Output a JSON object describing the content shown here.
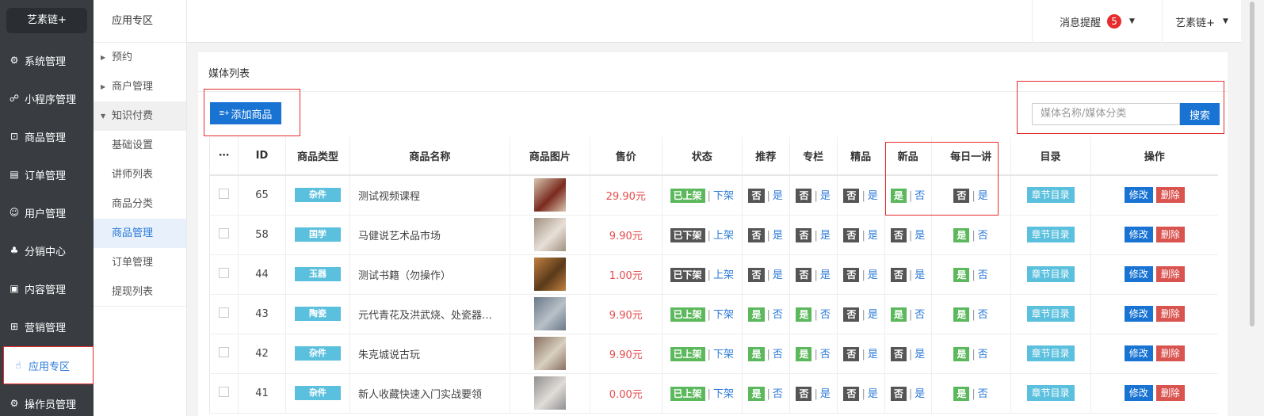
{
  "brand": "艺素链+",
  "sidebar": {
    "items": [
      {
        "label": "系统管理",
        "icon": "⚙"
      },
      {
        "label": "小程序管理",
        "icon": "☍"
      },
      {
        "label": "商品管理",
        "icon": "⊡"
      },
      {
        "label": "订单管理",
        "icon": "▤"
      },
      {
        "label": "用户管理",
        "icon": "☺"
      },
      {
        "label": "分销中心",
        "icon": "♣"
      },
      {
        "label": "内容管理",
        "icon": "▣"
      },
      {
        "label": "营销管理",
        "icon": "⊞"
      },
      {
        "label": "应用专区",
        "icon": "☝"
      },
      {
        "label": "操作员管理",
        "icon": "⚙"
      }
    ]
  },
  "subnav": {
    "title": "应用专区",
    "groups": [
      {
        "label": "预约"
      },
      {
        "label": "商户管理"
      },
      {
        "label": "知识付费"
      }
    ],
    "items": [
      {
        "label": "基础设置"
      },
      {
        "label": "讲师列表"
      },
      {
        "label": "商品分类"
      },
      {
        "label": "商品管理"
      },
      {
        "label": "订单管理"
      },
      {
        "label": "提现列表"
      }
    ]
  },
  "topbar": {
    "messages_label": "消息提醒",
    "messages_count": "5",
    "user_label": "艺素链+"
  },
  "panel": {
    "title": "媒体列表",
    "add_button": "添加商品",
    "search_placeholder": "媒体名称/媒体分类",
    "search_button": "搜索"
  },
  "table": {
    "headers": {
      "select": "⋯",
      "id": "ID",
      "type": "商品类型",
      "name": "商品名称",
      "image": "商品图片",
      "price": "售价",
      "status": "状态",
      "recommend": "推荐",
      "column": "专栏",
      "featured": "精品",
      "new": "新品",
      "daily": "每日一讲",
      "catalog": "目录",
      "actions": "操作"
    },
    "labels": {
      "yes": "是",
      "no": "否",
      "chapter": "章节目录",
      "edit": "修改",
      "delete": "删除",
      "on_shelf": "已上架",
      "off_shelf": "已下架",
      "to_off": "下架",
      "to_on": "上架"
    },
    "rows": [
      {
        "id": "65",
        "type": "杂件",
        "name": "测试视频课程",
        "price": "29.90元",
        "status_on": true,
        "recommend": false,
        "column": false,
        "featured": false,
        "new": true,
        "daily": false
      },
      {
        "id": "58",
        "type": "国学",
        "name": "马健说艺术品市场",
        "price": "9.90元",
        "status_on": false,
        "recommend": false,
        "column": false,
        "featured": false,
        "new": false,
        "daily": true
      },
      {
        "id": "44",
        "type": "玉器",
        "name": "测试书籍（勿操作）",
        "price": "1.00元",
        "status_on": false,
        "recommend": false,
        "column": false,
        "featured": false,
        "new": false,
        "daily": true
      },
      {
        "id": "43",
        "type": "陶瓷",
        "name": "元代青花及洪武烧、处瓷器…",
        "price": "9.90元",
        "status_on": true,
        "recommend": true,
        "column": true,
        "featured": false,
        "new": true,
        "daily": true
      },
      {
        "id": "42",
        "type": "杂件",
        "name": "朱克城说古玩",
        "price": "9.90元",
        "status_on": true,
        "recommend": true,
        "column": true,
        "featured": false,
        "new": false,
        "daily": true
      },
      {
        "id": "41",
        "type": "杂件",
        "name": "新人收藏快速入门实战要领",
        "price": "0.00元",
        "status_on": true,
        "recommend": true,
        "column": false,
        "featured": false,
        "new": false,
        "daily": true
      }
    ]
  }
}
